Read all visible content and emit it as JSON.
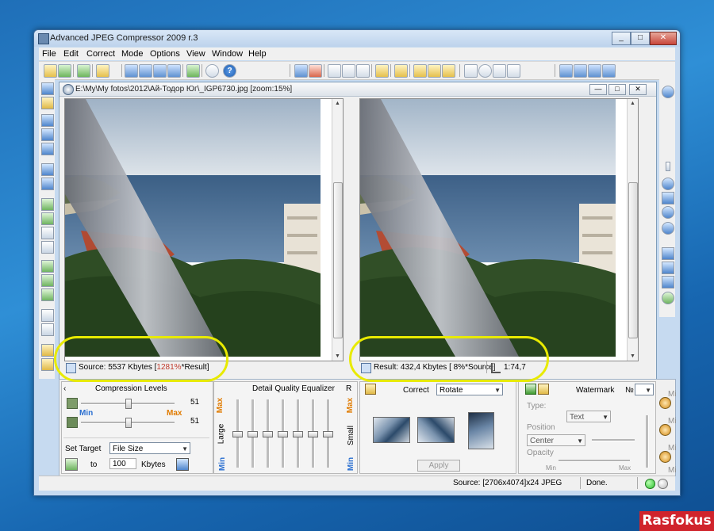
{
  "window": {
    "title": "Advanced JPEG Compressor 2009 r.3",
    "buttons": [
      "_",
      "□",
      "✕"
    ]
  },
  "menu": [
    "File",
    "Edit",
    "Correct",
    "Mode",
    "Options",
    "View",
    "Window",
    "Help"
  ],
  "toolbar": {
    "help_label": "?"
  },
  "document": {
    "title": "E:\\My\\My fotos\\2012\\Ай-Тодор Юг\\_IGP6730.jpg  [zoom:15%]",
    "controls": [
      "—",
      "□",
      "✕"
    ]
  },
  "source_info": {
    "prefix": "Source:",
    "size": "5537 Kbytes",
    "open": "[",
    "ratio": "1281%",
    "suffix": "*Result]"
  },
  "result_info": {
    "prefix": "Result:",
    "size": "432,4 Kbytes",
    "ratio": "[  8%*Source]",
    "compression": "1:74,7"
  },
  "compression": {
    "title": "Compression Levels",
    "value1": "51",
    "min_label": "Min",
    "max_label": "Max",
    "value2": "51",
    "set_target_label": "Set Target",
    "target_select": "File Size",
    "to_label": "to",
    "target_value": "100",
    "unit": "Kbytes",
    "arrow": "‹",
    "level": 0.5
  },
  "equalizer": {
    "title": "Detail Quality Equalizer",
    "r_label": "R",
    "max_label": "Max",
    "min_label": "Min",
    "large_label": "Large",
    "small_label": "Small",
    "max_right": "Max",
    "min_right": "Min",
    "levels": [
      0.5,
      0.5,
      0.5,
      0.5,
      0.5,
      0.5,
      0.5
    ]
  },
  "correct": {
    "label": "Correct",
    "selected": "Rotate",
    "apply_label": "Apply"
  },
  "watermark": {
    "label": "Watermark",
    "number_label": "№",
    "type_label": "Type:",
    "type_value": "Text",
    "position_label": "Position",
    "position_value": "Center",
    "opacity_label": "Opacity",
    "min_label": "Min",
    "max_label": "Max"
  },
  "extra_labels": [
    "Mi",
    "Mi",
    "Mi",
    "Mi"
  ],
  "status": {
    "source": "Source: [2706x4074]x24 JPEG",
    "state": "Done."
  },
  "watermark_logo": "Rasfokus",
  "colors": {
    "accent_red": "#c0392b",
    "highlight": "#e8ea00",
    "led_green": "#2fbf2f"
  }
}
